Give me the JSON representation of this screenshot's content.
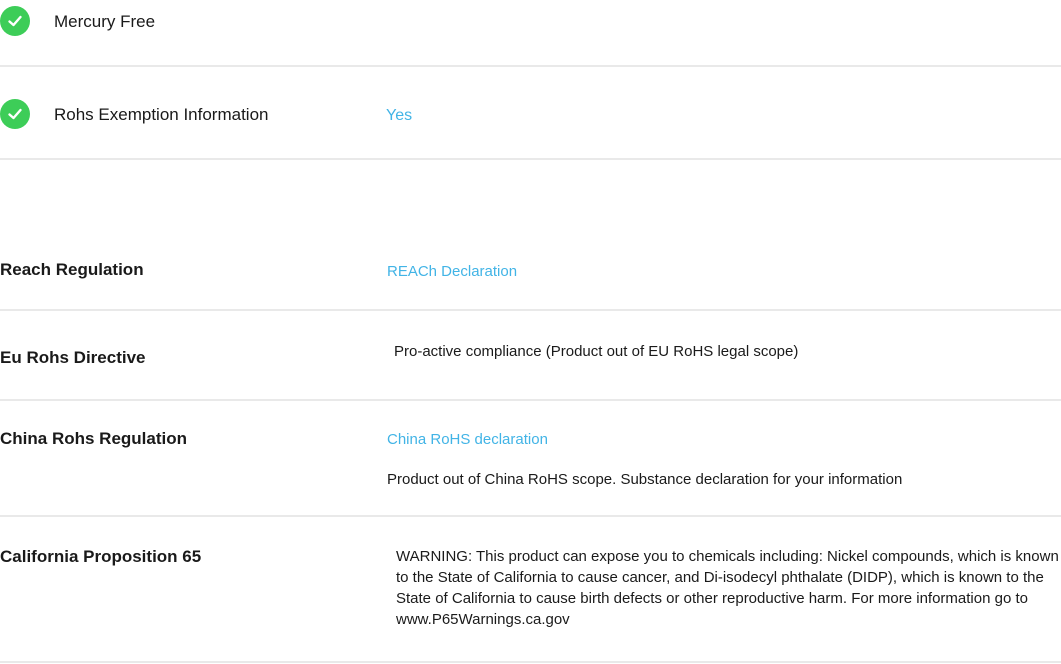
{
  "environmental": {
    "items": [
      {
        "label": "Mercury Free",
        "value": ""
      },
      {
        "label": "Rohs Exemption Information",
        "value": "Yes"
      }
    ]
  },
  "regulations": {
    "reach": {
      "label": "Reach Regulation",
      "link": "REACh Declaration"
    },
    "eu_rohs": {
      "label": "Eu Rohs Directive",
      "text": "Pro-active compliance (Product out of EU RoHS legal scope)"
    },
    "china_rohs": {
      "label": "China Rohs Regulation",
      "link": "China RoHS declaration",
      "text": "Product out of China RoHS scope. Substance declaration for your information"
    },
    "prop65": {
      "label": "California Proposition 65",
      "text": "WARNING: This product can expose you to chemicals including: Nickel compounds, which is known to the State of California to cause cancer, and Di-isodecyl phthalate (DIDP), which is known to the State of California to cause birth defects or other reproductive harm. For more information go to www.P65Warnings.ca.gov"
    }
  },
  "colors": {
    "check_green": "#3dcd58",
    "link_blue": "#42b4e6",
    "divider": "#e9e9e9"
  }
}
